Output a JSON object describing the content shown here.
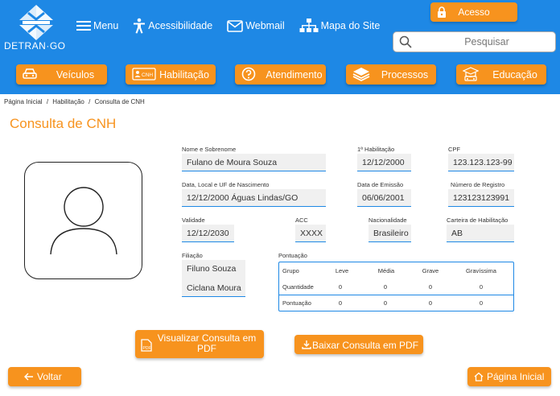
{
  "header": {
    "logo_text": "DETRAN·GO",
    "top_nav": {
      "menu": "Menu",
      "acessibilidade": "Acessibilidade",
      "webmail": "Webmail",
      "mapa": "Mapa do Site"
    },
    "acesso_label": "Acesso",
    "search_placeholder": "Pesquisar"
  },
  "main_nav": [
    {
      "label": "Veículos",
      "icon": "car-icon"
    },
    {
      "label": "Habilitação",
      "icon": "cnh-card-icon"
    },
    {
      "label": "Atendimento",
      "icon": "question-icon"
    },
    {
      "label": "Processos",
      "icon": "stack-icon"
    },
    {
      "label": "Educação",
      "icon": "education-icon"
    }
  ],
  "breadcrumb": {
    "items": [
      "Página Inicial",
      "Habilitação",
      "Consulta de CNH"
    ],
    "separator": "/"
  },
  "page_title": "Consulta de CNH",
  "fields": {
    "nome": {
      "label": "Nome e Sobrenome",
      "value": "Fulano de Moura Souza"
    },
    "primeira_hab": {
      "label": "1ª Habilitação",
      "value": "12/12/2000"
    },
    "cpf": {
      "label": "CPF",
      "value": "123.123.123-99"
    },
    "nascimento": {
      "label": "Data, Local e UF de Nascimento",
      "value": "12/12/2000 Águas Lindas/GO"
    },
    "emissao": {
      "label": "Data de Emissão",
      "value": "06/06/2001"
    },
    "registro": {
      "label": "Número de Registro",
      "value": "123123123991"
    },
    "validade": {
      "label": "Validade",
      "value": "12/12/2030"
    },
    "acc": {
      "label": "ACC",
      "value": "XXXX"
    },
    "nacionalidade": {
      "label": "Nacionalidade",
      "value": "Brasileiro"
    },
    "categoria": {
      "label": "Carteira de Habilitação",
      "value": "AB"
    },
    "filiacao": {
      "label": "Filiação",
      "pai": "Filuno Souza",
      "mae": "Ciclana Moura"
    }
  },
  "pontuacao": {
    "label": "Pontuação",
    "headers": [
      "Grupo",
      "Leve",
      "Média",
      "Grave",
      "Gravíssima"
    ],
    "rows": [
      [
        "Quantidade",
        "0",
        "0",
        "0",
        "0"
      ],
      [
        "Pontuação",
        "0",
        "0",
        "0",
        "0"
      ]
    ]
  },
  "actions": {
    "visualizar": "Visualizar Consulta em PDF",
    "baixar": "Baixar Consulta em PDF",
    "voltar": "Voltar",
    "pagina_inicial": "Página Inicial"
  },
  "colors": {
    "primary_blue": "#1e88e5",
    "accent_orange": "#f7931e"
  }
}
